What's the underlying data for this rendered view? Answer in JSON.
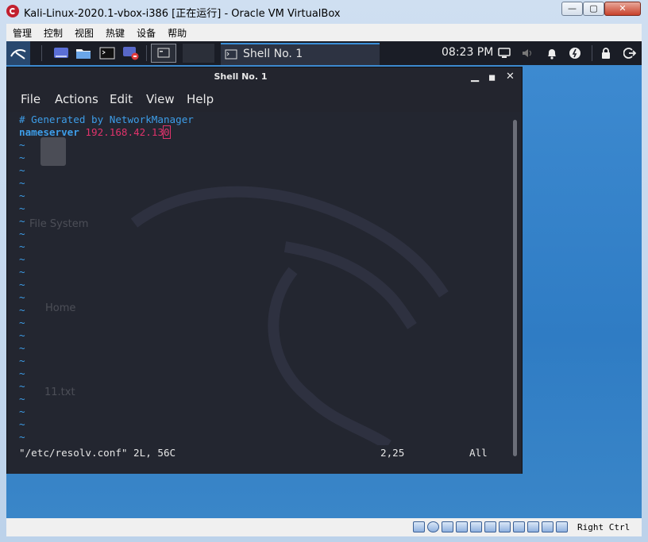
{
  "window": {
    "title": "Kali-Linux-2020.1-vbox-i386 [正在运行] - Oracle VM VirtualBox"
  },
  "vbox_menu": [
    "管理",
    "控制",
    "视图",
    "热键",
    "设备",
    "帮助"
  ],
  "panel": {
    "task_label": "Shell No. 1",
    "clock": "08:23 PM",
    "launchers": [
      "kali-dragon-icon",
      "desktop-icon",
      "folder-icon",
      "terminal-icon",
      "screen-recorder-icon",
      "workspace-icon"
    ],
    "tray": [
      "display-icon",
      "volume-icon",
      "bell-icon",
      "power-icon",
      "lock-icon",
      "logout-icon"
    ]
  },
  "terminal": {
    "title": "Shell No. 1",
    "menu": [
      "File",
      "Actions",
      "Edit",
      "View",
      "Help"
    ],
    "vim": {
      "comment_line": "# Generated by NetworkManager",
      "keyword": "nameserver",
      "ip_prefix": "192.168.42.13",
      "cursor_char": "0",
      "tilde_rows": 24,
      "status_left": "\"/etc/resolv.conf\" 2L, 56C",
      "status_pos": "2,25",
      "status_pct": "All"
    }
  },
  "desktop_icons": [
    "File System",
    "Home",
    "11.txt"
  ],
  "statusbar": {
    "host_key": "Right Ctrl"
  }
}
